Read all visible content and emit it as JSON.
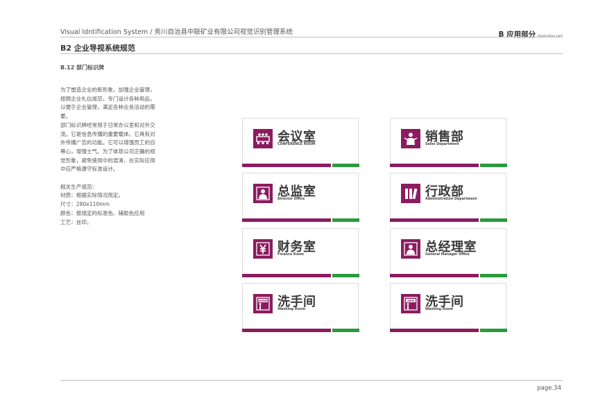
{
  "header": {
    "left_title": "Visual Idntification System / 务川自治县中联矿业有限公司视觉识别管理系统",
    "right_title": "B 应用部分",
    "right_subtitle": "Application part"
  },
  "section": {
    "title": "B2 企业导视系统规范",
    "subtitle": "B.12  部门标识牌"
  },
  "description": {
    "lines": [
      "为了塑造企业的新形象，加强企业管理，",
      "按照企业礼仪规范，专门设计各种用品，",
      "以便于企业管理，满足各种业务活动的需",
      "要。",
      "部门标识牌经常用于日常办公室和对外交",
      "流。它是信息传播的重要载体。它具有对",
      "外传播广告的功能。它可以增强员工的自",
      "尊心，增强士气。为了体现公司正确的视",
      "觉形象，避免使用中的混淆，在实际应用",
      "中应严格遵守标准设计。"
    ],
    "specs": [
      "相关生产规范：",
      "材质：根据实际情况而定。",
      "尺寸：280x110mm",
      "颜色：按规定的标准色、辅助色应用",
      "工艺：丝印。"
    ]
  },
  "signs": [
    {
      "cn": "会议室",
      "en": "CONFERENCE ROOM",
      "icon": "conference-icon"
    },
    {
      "cn": "销售部",
      "en": "Sales Department",
      "icon": "sales-person-icon"
    },
    {
      "cn": "总监室",
      "en": "Director Office",
      "icon": "director-person-icon"
    },
    {
      "cn": "行政部",
      "en": "Administration  Department",
      "icon": "files-icon"
    },
    {
      "cn": "财务室",
      "en": "Finance Room",
      "icon": "yen-icon"
    },
    {
      "cn": "总经理室",
      "en": "General Manager Office",
      "icon": "manager-person-icon"
    },
    {
      "cn": "洗手间",
      "en": "Washing Room",
      "icon": "women-restroom-icon",
      "icon_text": "WOMEN"
    },
    {
      "cn": "洗手间",
      "en": "Washing Room",
      "icon": "men-restroom-icon",
      "icon_text": "MEN"
    }
  ],
  "colors": {
    "primary_purple": "#8b1c5f",
    "accent_green": "#2a9a3c"
  },
  "footer": {
    "page": "page.34"
  }
}
